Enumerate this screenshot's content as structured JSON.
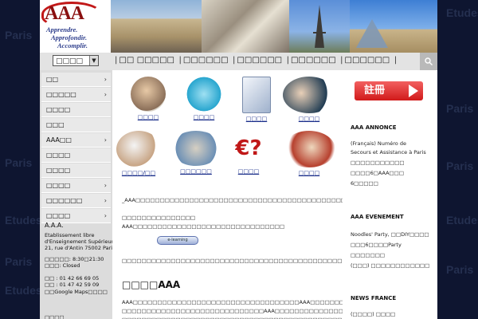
{
  "background_words": [
    "Etudes",
    "Paris",
    "Paris",
    "Paris",
    "Paris",
    "Paris",
    "Paris",
    "Etudes",
    "Etudes",
    "Etudes"
  ],
  "logo": {
    "mark": "AAA",
    "tagline": [
      "Apprendre.",
      "Approfondir.",
      "Accomplir."
    ]
  },
  "nav": {
    "select_value": "□□□□",
    "links": [
      "□□ □□□□□",
      "□□□□□□",
      "□□□□□□",
      "□□□□□□",
      "□□□□□□"
    ],
    "search_icon": "search-icon"
  },
  "sidebar": {
    "items": [
      {
        "label": "□□",
        "chevron": "›"
      },
      {
        "label": "□□□□□",
        "chevron": "›"
      },
      {
        "label": "□□□□",
        "chevron": ""
      },
      {
        "label": "□□□",
        "chevron": ""
      },
      {
        "label": "AAA□□",
        "chevron": "›"
      },
      {
        "label": "□□□□",
        "chevron": ""
      },
      {
        "label": "□□□□",
        "chevron": ""
      },
      {
        "label": "□□□□",
        "chevron": "›"
      },
      {
        "label": "□□□□□□",
        "chevron": "›"
      },
      {
        "label": "□□□□",
        "chevron": "›"
      }
    ],
    "info": {
      "name": "A.A.A.",
      "line1": "Etablissement libre",
      "line2": "d'Enseignement Supérieur",
      "line3": "21, rue d'Antin 75002 Paris",
      "hours1": "□□□□□: 8:30□21:30",
      "hours2": "□□□: Closed",
      "phone": "□□ : 01 42 66 69 05",
      "fax": "□□ : 01 47 42 59 09",
      "maps": "□□Google Maps□□□□",
      "bottom": "□□□□"
    }
  },
  "tiles": [
    {
      "label": "□□□□"
    },
    {
      "label": "□□□□"
    },
    {
      "label": "□□□□"
    },
    {
      "label": "□□□□"
    },
    {
      "label": "□□□□/□□"
    },
    {
      "label": "□□□□□□"
    },
    {
      "label": "□□□□"
    },
    {
      "label": "□□□□"
    }
  ],
  "main": {
    "para1": "_AAA□□□□□□□□□□□□□□□□□□□□□□□□□□□□□□□□□□□□□□□□□□□□□□□□□□",
    "para2": "□□□□□□□□□□□□□□□ AAA□□□□□□□□□□□□□□□□□□□□□□□□□□□□□□□",
    "elearning_badge": "e-learning",
    "para3": "□□□□□□□□□□□□□□□□□□□□□□□□□□□□□□□□□□□□□□□□□□□□□□□□□□□",
    "title": "□□□□AAA",
    "para4": "AAA□□□□□□□□□□□□□□□□□□□□□□□□□□□□□□□□□□AAA□□□□□□□□□□□□□□□□□□□",
    "para5": "□□□□□□□□□□□□□□□□□□□□□□□□□□□□□AAA□□□□□□□□□□□□□□□□□□□□AAA□□□□",
    "para6": "□□□□□□□□□□□□□□□□□□□□□□□□□□□□□□□□□□□□□□□□□□□□□□□□□□□□□□"
  },
  "right": {
    "register_label": "註冊",
    "annonce_title": "AAA ANNONCE",
    "annonce_lines": [
      "(Français) Numéro de",
      "Secours et Assistance à Paris",
      "□□□□□□□□□□□",
      "□□□□6□AAA□□□",
      "6□□□□□"
    ],
    "event_title": "AAA EVENEMENT",
    "event_lines": [
      "Noodles' Party, □□DIY□□□□",
      "□□□6□□□□Party",
      "□□□□□□□",
      "(□□□) □□□□□□□□□□□□"
    ],
    "news_title": "NEWS FRANCE",
    "news_lines": [
      "(□□□□) □□□□"
    ]
  },
  "colors": {
    "page_bg": "#0e1530",
    "accent_red": "#d11a1a",
    "link_blue": "#1a2e8a"
  }
}
